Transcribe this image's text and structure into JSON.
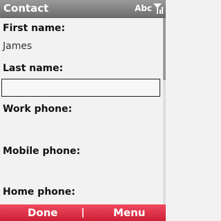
{
  "title_bar": {
    "title": "Contact",
    "input_mode": "Abc",
    "signal_icon": "signal-strength-icon"
  },
  "form": {
    "first_name_label": "First name:",
    "first_name_value": "James",
    "last_name_label": "Last name:",
    "last_name_value": "",
    "work_phone_label": "Work phone:",
    "mobile_phone_label": "Mobile phone:",
    "home_phone_label": "Home phone:"
  },
  "softkeys": {
    "left": "Done",
    "right": "Menu"
  },
  "colors": {
    "title_bar": "#7f7f7f",
    "softkey_bar": "#e23047",
    "background": "#f2f2f2"
  }
}
